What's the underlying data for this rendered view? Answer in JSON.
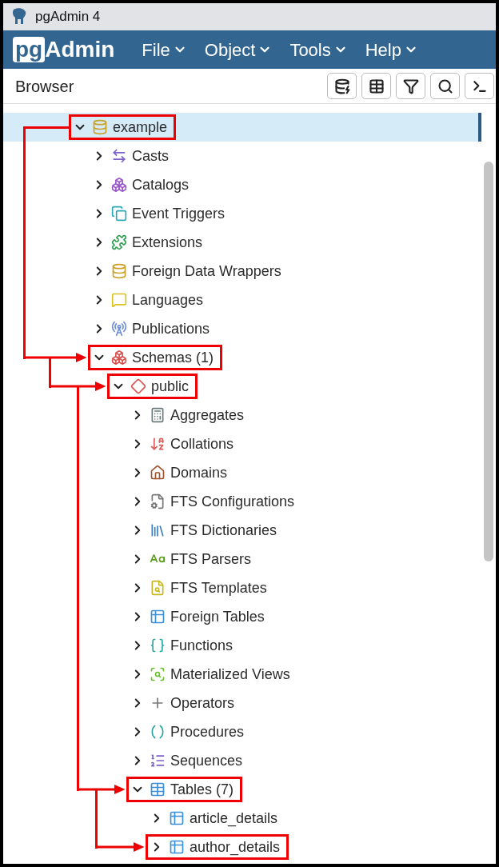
{
  "window": {
    "title": "pgAdmin 4"
  },
  "logo": {
    "boxed": "pg",
    "rest": "Admin"
  },
  "menu": [
    {
      "label": "File"
    },
    {
      "label": "Object"
    },
    {
      "label": "Tools"
    },
    {
      "label": "Help"
    }
  ],
  "panel": {
    "title": "Browser"
  },
  "tree": [
    {
      "label": "example",
      "kind": "database",
      "expanded": true,
      "selected": true,
      "highlighted": true,
      "children": [
        {
          "label": "Casts",
          "kind": "cast",
          "expanded": false,
          "selected": false,
          "highlighted": false
        },
        {
          "label": "Catalogs",
          "kind": "catalog",
          "expanded": false,
          "selected": false,
          "highlighted": false
        },
        {
          "label": "Event Triggers",
          "kind": "event_trigger",
          "expanded": false,
          "selected": false,
          "highlighted": false
        },
        {
          "label": "Extensions",
          "kind": "extension",
          "expanded": false,
          "selected": false,
          "highlighted": false
        },
        {
          "label": "Foreign Data Wrappers",
          "kind": "fdw",
          "expanded": false,
          "selected": false,
          "highlighted": false
        },
        {
          "label": "Languages",
          "kind": "language",
          "expanded": false,
          "selected": false,
          "highlighted": false
        },
        {
          "label": "Publications",
          "kind": "publication",
          "expanded": false,
          "selected": false,
          "highlighted": false
        },
        {
          "label": "Schemas (1)",
          "kind": "schemas",
          "expanded": true,
          "selected": false,
          "highlighted": true,
          "children": [
            {
              "label": "public",
              "kind": "schema",
              "expanded": true,
              "selected": false,
              "highlighted": true,
              "children": [
                {
                  "label": "Aggregates",
                  "kind": "aggregate",
                  "expanded": false,
                  "selected": false,
                  "highlighted": false
                },
                {
                  "label": "Collations",
                  "kind": "collation",
                  "expanded": false,
                  "selected": false,
                  "highlighted": false
                },
                {
                  "label": "Domains",
                  "kind": "domain",
                  "expanded": false,
                  "selected": false,
                  "highlighted": false
                },
                {
                  "label": "FTS Configurations",
                  "kind": "fts_config",
                  "expanded": false,
                  "selected": false,
                  "highlighted": false
                },
                {
                  "label": "FTS Dictionaries",
                  "kind": "fts_dict",
                  "expanded": false,
                  "selected": false,
                  "highlighted": false
                },
                {
                  "label": "FTS Parsers",
                  "kind": "fts_parser",
                  "expanded": false,
                  "selected": false,
                  "highlighted": false
                },
                {
                  "label": "FTS Templates",
                  "kind": "fts_template",
                  "expanded": false,
                  "selected": false,
                  "highlighted": false
                },
                {
                  "label": "Foreign Tables",
                  "kind": "foreign_table",
                  "expanded": false,
                  "selected": false,
                  "highlighted": false
                },
                {
                  "label": "Functions",
                  "kind": "function",
                  "expanded": false,
                  "selected": false,
                  "highlighted": false
                },
                {
                  "label": "Materialized Views",
                  "kind": "matview",
                  "expanded": false,
                  "selected": false,
                  "highlighted": false
                },
                {
                  "label": "Operators",
                  "kind": "operator",
                  "expanded": false,
                  "selected": false,
                  "highlighted": false
                },
                {
                  "label": "Procedures",
                  "kind": "procedure",
                  "expanded": false,
                  "selected": false,
                  "highlighted": false
                },
                {
                  "label": "Sequences",
                  "kind": "sequence",
                  "expanded": false,
                  "selected": false,
                  "highlighted": false
                },
                {
                  "label": "Tables (7)",
                  "kind": "tables",
                  "expanded": true,
                  "selected": false,
                  "highlighted": true,
                  "children": [
                    {
                      "label": "article_details",
                      "kind": "table",
                      "expanded": false,
                      "selected": false,
                      "highlighted": false
                    },
                    {
                      "label": "author_details",
                      "kind": "table",
                      "expanded": false,
                      "selected": false,
                      "highlighted": true
                    }
                  ]
                }
              ]
            }
          ]
        }
      ]
    }
  ]
}
